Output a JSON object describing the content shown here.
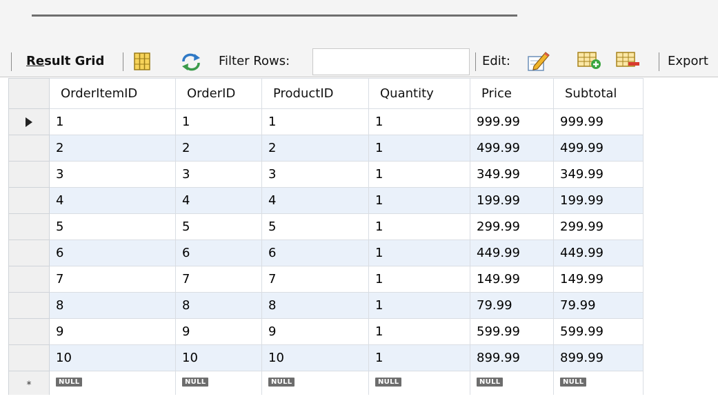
{
  "toolbar": {
    "result_grid_prefix": "Re",
    "result_grid_rest": "sult Grid",
    "filter_label": "Filter Rows:",
    "filter_value": "",
    "edit_label": "Edit:",
    "export_label": "Export"
  },
  "icons": {
    "grid_view": "grid-view-icon",
    "refresh": "refresh-arrows-icon",
    "edit_pencil": "edit-pencil-icon",
    "add_row": "add-row-icon",
    "delete_row": "delete-row-icon",
    "current_row": "current-row-arrow-icon",
    "new_row": "new-row-star-icon"
  },
  "colors": {
    "alt_row": "#eaf1fa",
    "null_badge": "#6d6d6d",
    "toolbar_bg": "#f4f4f4"
  },
  "grid": {
    "columns": [
      "OrderItemID",
      "OrderID",
      "ProductID",
      "Quantity",
      "Price",
      "Subtotal"
    ],
    "rows": [
      [
        "1",
        "1",
        "1",
        "1",
        "999.99",
        "999.99"
      ],
      [
        "2",
        "2",
        "2",
        "1",
        "499.99",
        "499.99"
      ],
      [
        "3",
        "3",
        "3",
        "1",
        "349.99",
        "349.99"
      ],
      [
        "4",
        "4",
        "4",
        "1",
        "199.99",
        "199.99"
      ],
      [
        "5",
        "5",
        "5",
        "1",
        "299.99",
        "299.99"
      ],
      [
        "6",
        "6",
        "6",
        "1",
        "449.99",
        "449.99"
      ],
      [
        "7",
        "7",
        "7",
        "1",
        "149.99",
        "149.99"
      ],
      [
        "8",
        "8",
        "8",
        "1",
        "79.99",
        "79.99"
      ],
      [
        "9",
        "9",
        "9",
        "1",
        "599.99",
        "599.99"
      ],
      [
        "10",
        "10",
        "10",
        "1",
        "899.99",
        "899.99"
      ]
    ],
    "new_row_marker": "*",
    "null_label": "NULL"
  }
}
